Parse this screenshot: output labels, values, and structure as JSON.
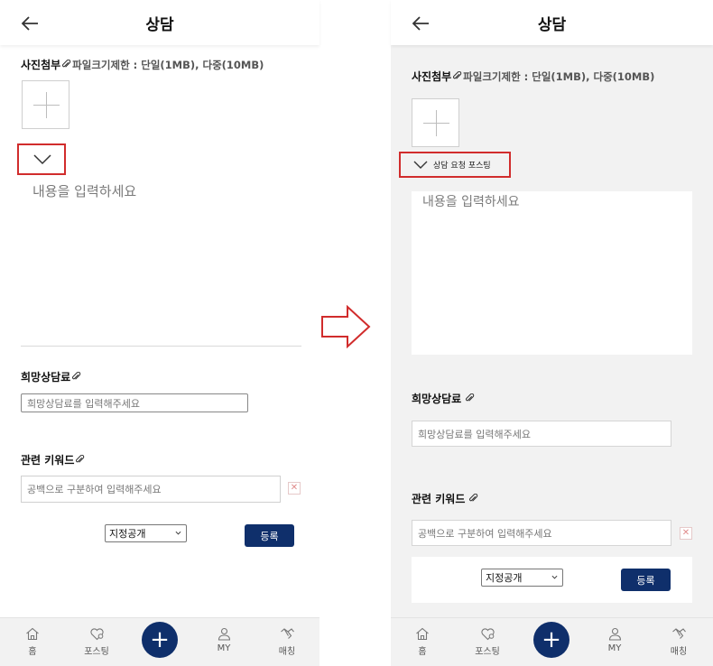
{
  "screen_title": "상담",
  "photo_section": {
    "label": "사진첨부",
    "size_note": "파일크기제한 : 단일(1MB), 다중(10MB)"
  },
  "posting_toggle_label": "상담 요청 포스팅",
  "content_placeholder": "내용을 입력하세요",
  "fee_section": {
    "label": "희망상담료",
    "placeholder": "희망상담료를 입력해주세요"
  },
  "keyword_section": {
    "label": "관련 키워드",
    "placeholder": "공백으로 구분하여 입력해주세요",
    "clear_glyph": "✕"
  },
  "visibility_select": {
    "value": "지정공개"
  },
  "submit_label": "등록",
  "bottom_nav": {
    "home": "홈",
    "posting": "포스팅",
    "add": "+",
    "my": "MY",
    "matching": "매칭"
  },
  "colors": {
    "primary": "#0f2f6b",
    "highlight": "#d12c2c",
    "right_background": "#f2f2f2"
  }
}
